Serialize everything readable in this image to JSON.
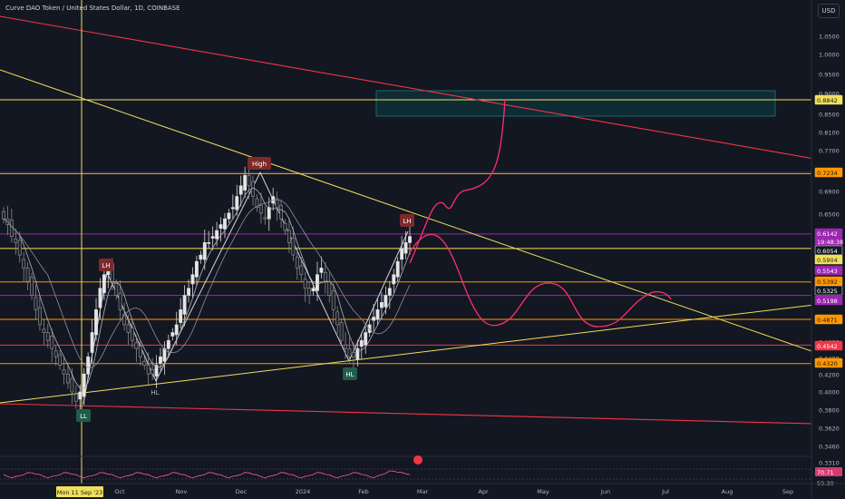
{
  "header": {
    "title": "Curve DAO Token / United States Dollar, 1D, COINBASE",
    "currency_button": "USD"
  },
  "chart_data": {
    "type": "candlestick",
    "instrument": "Curve DAO Token / United States Dollar",
    "interval": "1D",
    "exchange": "COINBASE",
    "y_scale": "log",
    "ylim": [
      0.33,
      1.1
    ],
    "x_tick_labels": [
      "Oct",
      "Nov",
      "Dec",
      "2024",
      "Feb",
      "Mar",
      "Apr",
      "May",
      "Jun",
      "Jul",
      "Aug",
      "Sep"
    ],
    "crosshair_date_label": "Mon 11 Sep '23",
    "y_tick_labels": [
      "1.0500",
      "1.0000",
      "0.9500",
      "0.9000",
      "0.8500",
      "0.8100",
      "0.7700",
      "0.6900",
      "0.6500",
      "0.6400",
      "0.4600",
      "0.4200",
      "0.4000",
      "0.3800",
      "0.3620",
      "0.3460",
      "0.3310"
    ],
    "price_tags": [
      {
        "label": "0.8842",
        "color": "#f0e05a"
      },
      {
        "label": "0.7234",
        "color": "#ff9800"
      },
      {
        "label": "0.6142",
        "color": "#9c27b0"
      },
      {
        "label": "19:48:38",
        "color": "#9c27b0"
      },
      {
        "label": "0.6054",
        "color": "#131722"
      },
      {
        "label": "0.5904",
        "color": "#f0e05a"
      },
      {
        "label": "0.5543",
        "color": "#9c27b0"
      },
      {
        "label": "0.5392",
        "color": "#ff9800"
      },
      {
        "label": "0.5325",
        "color": "#131722"
      },
      {
        "label": "0.5198",
        "color": "#9c27b0"
      },
      {
        "label": "0.4871",
        "color": "#ff9800"
      },
      {
        "label": "0.4542",
        "color": "#f23645"
      },
      {
        "label": "0.4320",
        "color": "#ff9800"
      }
    ],
    "close_series": [
      0.64,
      0.63,
      0.61,
      0.6,
      0.58,
      0.56,
      0.54,
      0.52,
      0.5,
      0.48,
      0.47,
      0.46,
      0.45,
      0.44,
      0.43,
      0.42,
      0.41,
      0.4,
      0.39,
      0.4,
      0.42,
      0.44,
      0.47,
      0.5,
      0.53,
      0.55,
      0.56,
      0.54,
      0.52,
      0.5,
      0.48,
      0.47,
      0.46,
      0.45,
      0.44,
      0.43,
      0.42,
      0.42,
      0.43,
      0.44,
      0.45,
      0.46,
      0.47,
      0.48,
      0.5,
      0.52,
      0.53,
      0.55,
      0.57,
      0.58,
      0.6,
      0.6,
      0.61,
      0.62,
      0.63,
      0.64,
      0.65,
      0.66,
      0.68,
      0.7,
      0.72,
      0.7,
      0.68,
      0.66,
      0.65,
      0.64,
      0.66,
      0.68,
      0.66,
      0.64,
      0.62,
      0.6,
      0.58,
      0.56,
      0.55,
      0.53,
      0.52,
      0.53,
      0.55,
      0.56,
      0.54,
      0.52,
      0.5,
      0.48,
      0.46,
      0.45,
      0.44,
      0.44,
      0.45,
      0.46,
      0.47,
      0.48,
      0.49,
      0.5,
      0.51,
      0.52,
      0.53,
      0.55,
      0.57,
      0.59,
      0.6,
      0.61
    ],
    "horizontal_levels": [
      0.8842,
      0.7234,
      0.6142,
      0.5904,
      0.5392,
      0.5198,
      0.4871,
      0.4542,
      0.432
    ],
    "annotations": [
      {
        "text": "High"
      },
      {
        "text": "LH"
      },
      {
        "text": "LH"
      },
      {
        "text": "HL"
      },
      {
        "text": "HL"
      },
      {
        "text": "LL"
      }
    ],
    "oscillator": {
      "labels": [
        "70.71",
        "59.30"
      ]
    }
  }
}
